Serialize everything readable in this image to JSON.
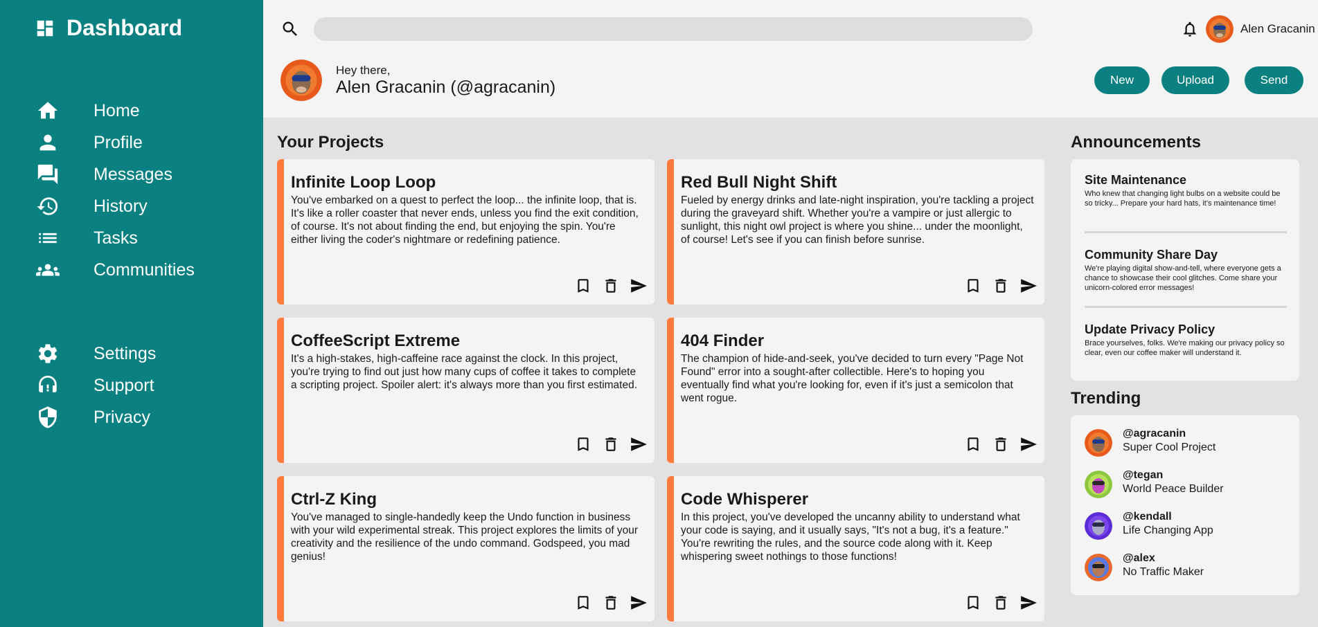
{
  "brand": {
    "title": "Dashboard"
  },
  "nav": {
    "main": [
      {
        "label": "Home",
        "icon": "home-icon"
      },
      {
        "label": "Profile",
        "icon": "person-icon"
      },
      {
        "label": "Messages",
        "icon": "chat-icon"
      },
      {
        "label": "History",
        "icon": "history-icon"
      },
      {
        "label": "Tasks",
        "icon": "list-icon"
      },
      {
        "label": "Communities",
        "icon": "groups-icon"
      }
    ],
    "secondary": [
      {
        "label": "Settings",
        "icon": "gear-icon"
      },
      {
        "label": "Support",
        "icon": "headset-icon"
      },
      {
        "label": "Privacy",
        "icon": "shield-icon"
      }
    ]
  },
  "header": {
    "search_placeholder": "",
    "username": "Alen Gracanin",
    "greeting": "Hey there,",
    "fullname": "Alen Gracanin (@agracanin)",
    "buttons": {
      "new": "New",
      "upload": "Upload",
      "send": "Send"
    }
  },
  "projects": {
    "title": "Your Projects",
    "items": [
      {
        "title": "Infinite Loop Loop",
        "desc": "You've embarked on a quest to perfect the loop... the infinite loop, that is. It's like a roller coaster that never ends, unless you find the exit condition, of course. It's not about finding the end, but enjoying the spin. You're either living the coder's nightmare or redefining patience."
      },
      {
        "title": "Red Bull Night Shift",
        "desc": "Fueled by energy drinks and late-night inspiration, you're tackling a project during the graveyard shift. Whether you're a vampire or just allergic to sunlight, this night owl project is where you shine... under the moonlight, of course! Let's see if you can finish before sunrise."
      },
      {
        "title": "CoffeeScript Extreme",
        "desc": "It's a high-stakes, high-caffeine race against the clock. In this project, you're trying to find out just how many cups of coffee it takes to complete a scripting project. Spoiler alert: it's always more than you first estimated."
      },
      {
        "title": "404 Finder",
        "desc": "The champion of hide-and-seek, you've decided to turn every \"Page Not Found\" error into a sought-after collectible. Here's to hoping you eventually find what you're looking for, even if it's just a semicolon that went rogue."
      },
      {
        "title": "Ctrl-Z King",
        "desc": "You've managed to single-handedly keep the Undo function in business with your wild experimental streak. This project explores the limits of your creativity and the resilience of the undo command. Godspeed, you mad genius!"
      },
      {
        "title": "Code Whisperer",
        "desc": "In this project, you've developed the uncanny ability to understand what your code is saying, and it usually says, \"It's not a bug, it's a feature.\" You're rewriting the rules, and the source code along with it. Keep whispering sweet nothings to those functions!"
      }
    ]
  },
  "announcements": {
    "title": "Announcements",
    "items": [
      {
        "title": "Site Maintenance",
        "desc": "Who knew that changing light bulbs on a website could be so tricky... Prepare your hard hats, it's maintenance time!"
      },
      {
        "title": "Community Share Day",
        "desc": "We're playing digital show-and-tell, where everyone gets a chance to showcase their cool glitches. Come share your unicorn-colored error messages!"
      },
      {
        "title": "Update Privacy Policy",
        "desc": "Brace yourselves, folks. We're making our privacy policy so clear, even our coffee maker will understand it."
      }
    ]
  },
  "trending": {
    "title": "Trending",
    "items": [
      {
        "handle": "@agracanin",
        "project": "Super Cool Project"
      },
      {
        "handle": "@tegan",
        "project": "World Peace Builder"
      },
      {
        "handle": "@kendall",
        "project": "Life Changing App"
      },
      {
        "handle": "@alex",
        "project": "No Traffic Maker"
      }
    ]
  },
  "colors": {
    "sidebar": "#0b8080",
    "accent": "#ff7b3d",
    "button": "#0b8080",
    "background": "#e2e2e2",
    "card": "#f4f4f4"
  }
}
